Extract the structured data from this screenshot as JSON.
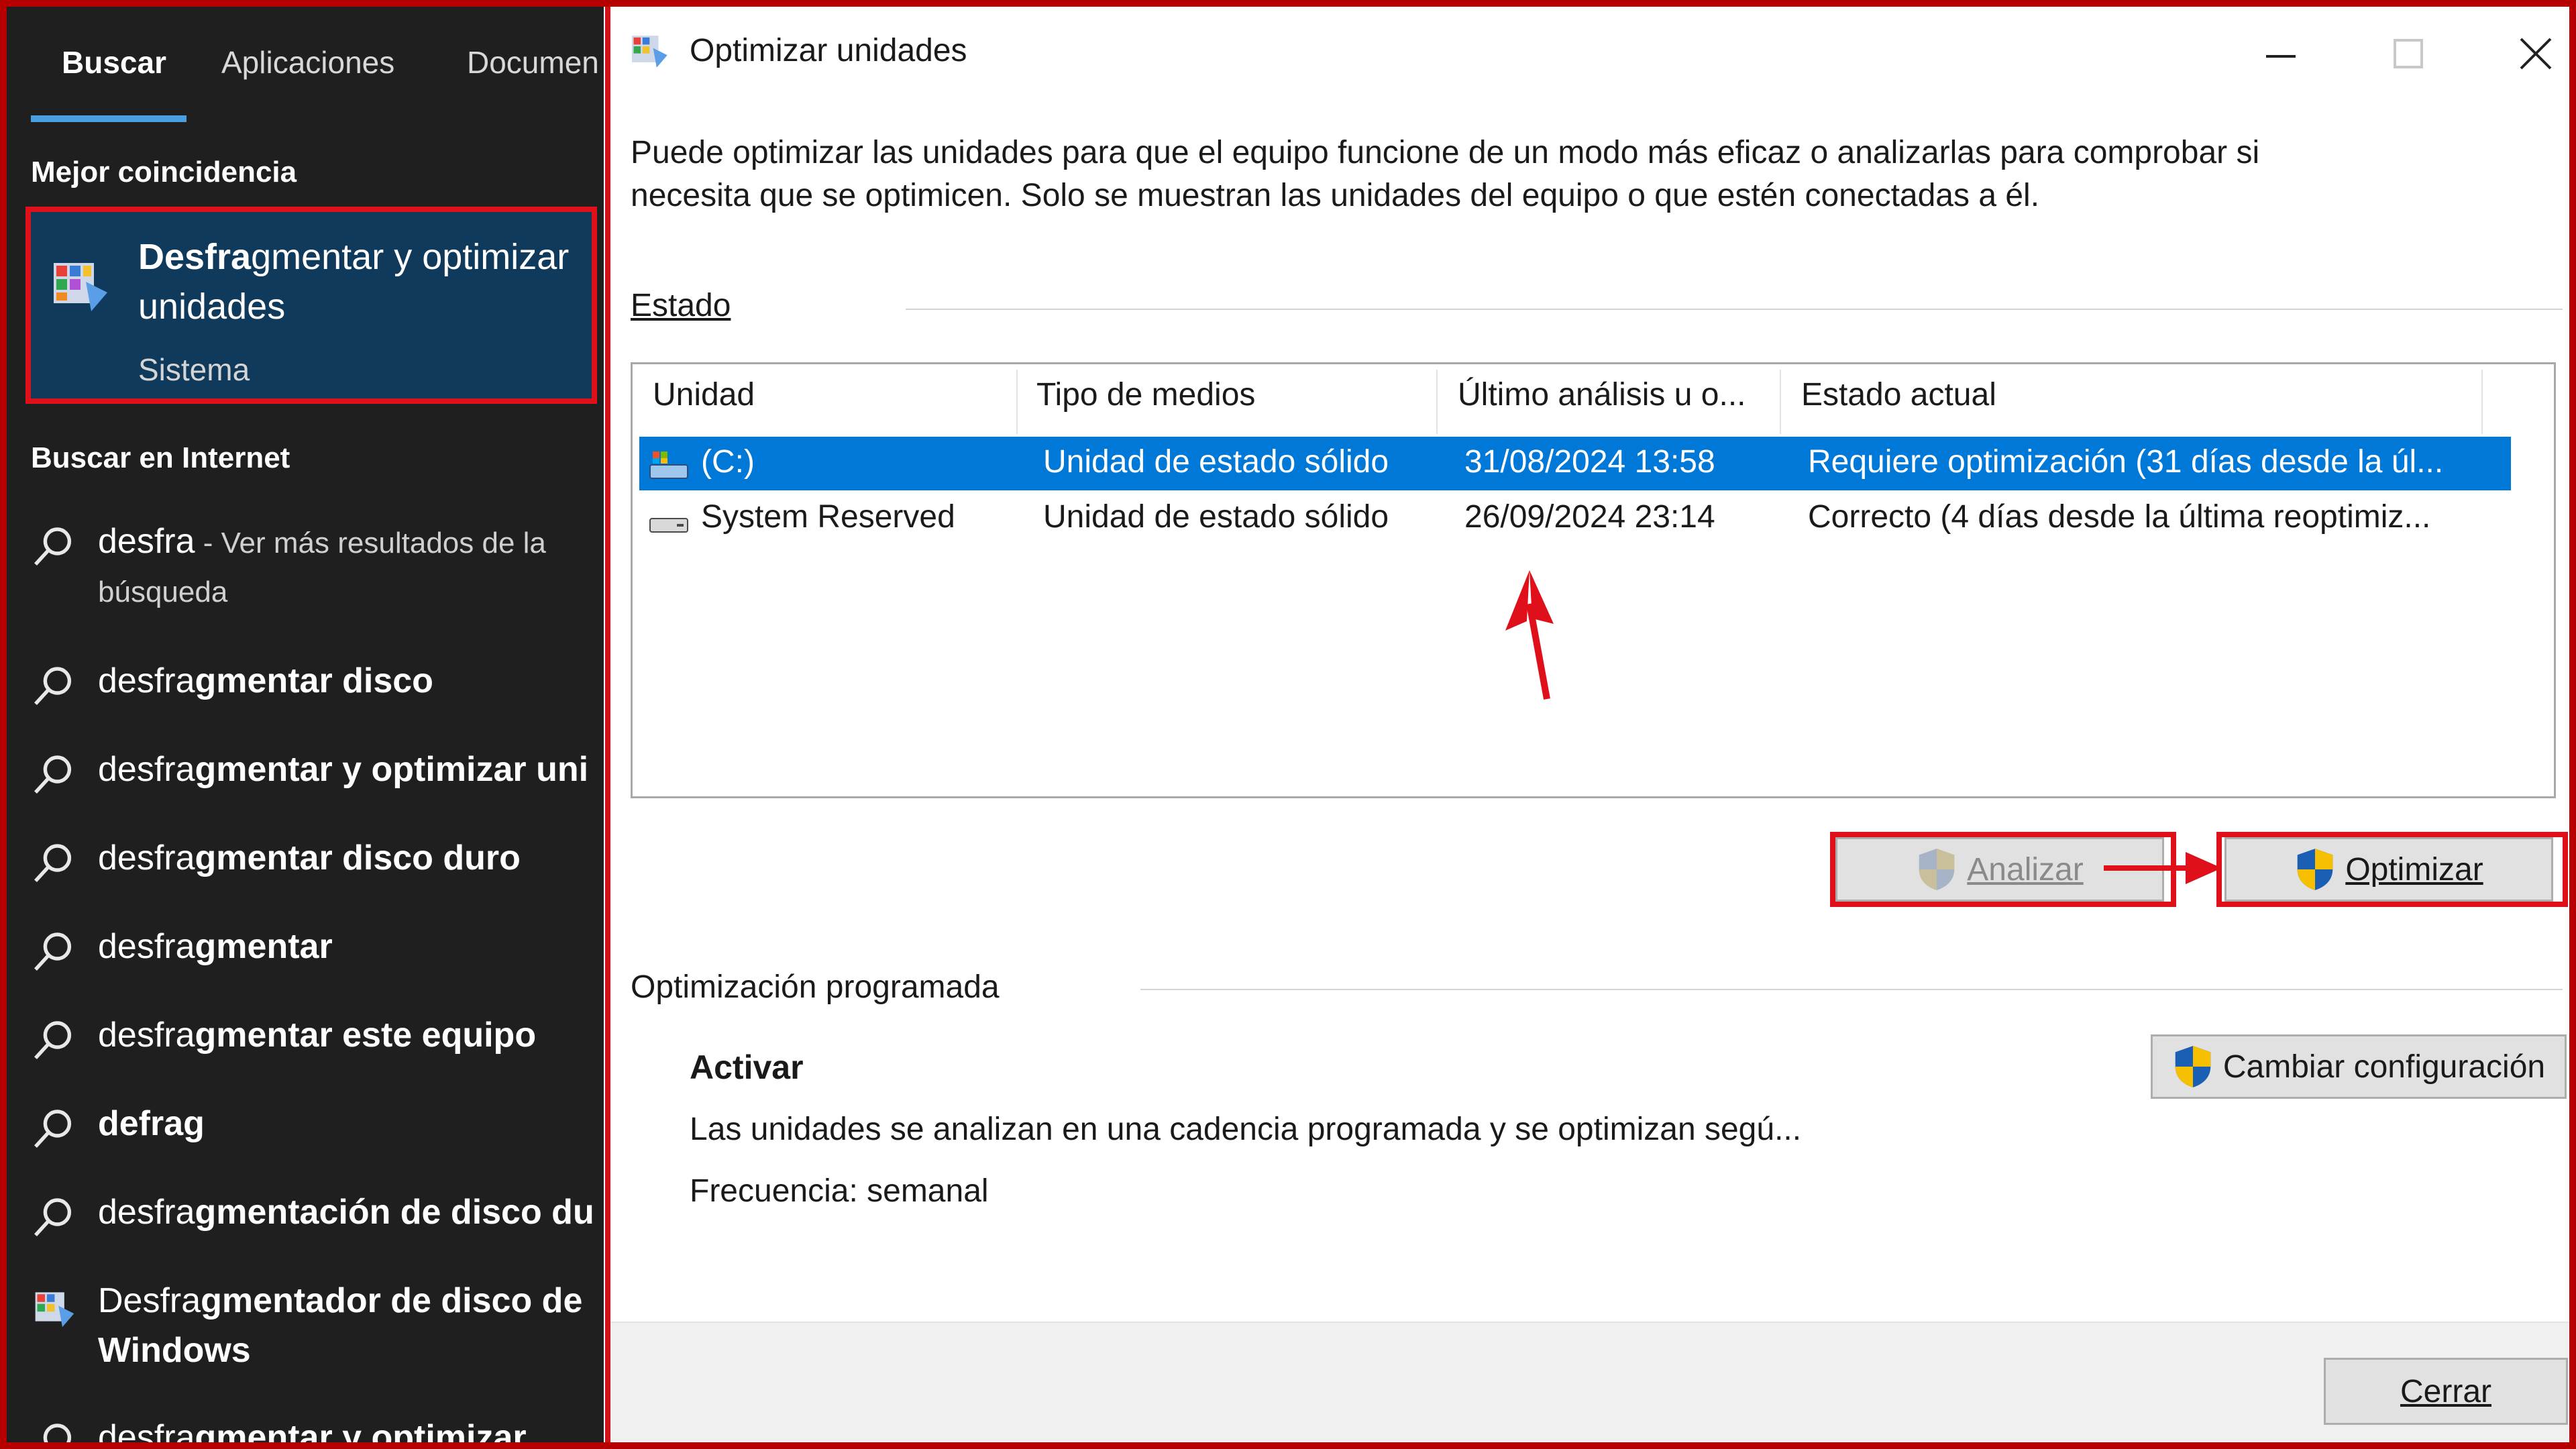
{
  "search_panel": {
    "tabs": [
      "Buscar",
      "Aplicaciones",
      "Documen"
    ],
    "best_match_header": "Mejor coincidencia",
    "best_match": {
      "title_bold": "Desfra",
      "title_rest": "gmentar y optimizar unidades",
      "subtitle": "Sistema"
    },
    "internet_header": "Buscar en Internet",
    "results": [
      {
        "bold": "desfra",
        "rest": "",
        "hint": " - Ver más resultados de la",
        "line2": "búsqueda"
      },
      {
        "bold": "desfra",
        "rest": "gmentar disco"
      },
      {
        "bold": "desfra",
        "rest": "gmentar y optimizar uni"
      },
      {
        "bold": "desfra",
        "rest": "gmentar disco duro"
      },
      {
        "bold": "desfra",
        "rest": "gmentar"
      },
      {
        "bold": "desfra",
        "rest": "gmentar este equipo"
      },
      {
        "bold": "defrag",
        "rest": ""
      },
      {
        "bold": "desfra",
        "rest": "gmentación de disco du"
      },
      {
        "bold": "Desfra",
        "rest": "gmentador de disco de",
        "line2": "Windows"
      },
      {
        "bold": "desfra",
        "rest": "gmentar y optimizar"
      }
    ]
  },
  "dialog": {
    "title": "Optimizar unidades",
    "description_line1": "Puede optimizar las unidades para que el equipo funcione de un modo más eficaz o analizarlas para comprobar si",
    "description_line2": "necesita que se optimicen. Solo se muestran las unidades del equipo o que estén conectadas a él.",
    "status_label": "Estado",
    "columns": [
      "Unidad",
      "Tipo de medios",
      "Último análisis u o...",
      "Estado actual"
    ],
    "rows": [
      {
        "unit": "(C:)",
        "media": "Unidad de estado sólido",
        "last": "31/08/2024 13:58",
        "state": "Requiere optimización (31 días desde la úl...",
        "selected": true
      },
      {
        "unit": "System Reserved",
        "media": "Unidad de estado sólido",
        "last": "26/09/2024 23:14",
        "state": "Correcto (4 días desde la última reoptimiz...",
        "selected": false
      }
    ],
    "analyze_label": "Analizar",
    "optimize_label": "Optimizar",
    "scheduled_label": "Optimización programada",
    "activate_label": "Activar",
    "change_config_label": "Cambiar configuración",
    "schedule_desc": "Las unidades se analizan en una cadencia programada y se optimizan segú...",
    "frequency": "Frecuencia: semanal",
    "close_label": "Cerrar"
  },
  "colors": {
    "selection": "#0078d7",
    "highlight": "#e0101a",
    "search_bg": "#1f1f1f",
    "tab_underline": "#4a9fe0"
  }
}
